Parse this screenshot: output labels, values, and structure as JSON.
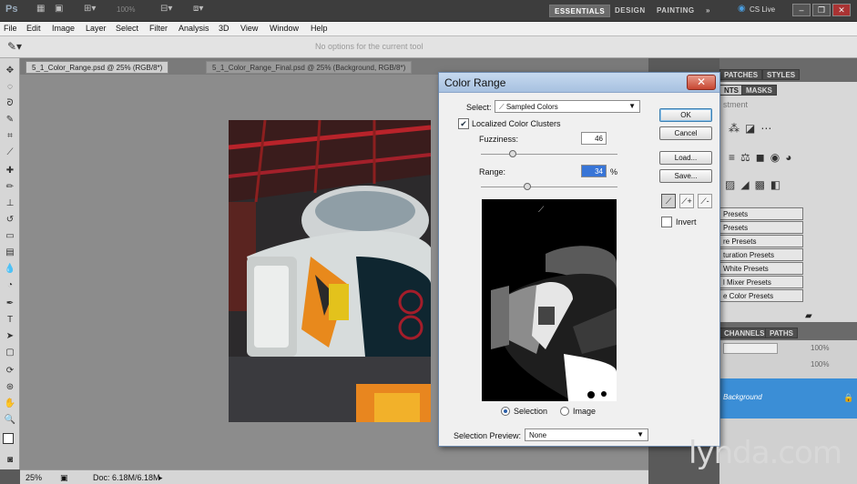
{
  "app": {
    "logo": "Ps",
    "zoom": "100%",
    "workspaces": [
      "ESSENTIALS",
      "DESIGN",
      "PAINTING"
    ],
    "more": "»",
    "cs_live": "CS Live",
    "menu": [
      "File",
      "Edit",
      "Image",
      "Layer",
      "Select",
      "Filter",
      "Analysis",
      "3D",
      "View",
      "Window",
      "Help"
    ],
    "options_message": "No options for the current tool"
  },
  "documents": {
    "tabs": [
      {
        "label": "5_1_Color_Range.psd @ 25% (RGB/8*)",
        "active": true
      },
      {
        "label": "5_1_Color_Range_Final.psd @ 25% (Background, RGB/8*)",
        "active": false
      }
    ]
  },
  "status": {
    "zoom": "25%",
    "doc": "Doc: 6.18M/6.18M"
  },
  "panels": {
    "top_tabs": [
      "PATCHES",
      "STYLES"
    ],
    "adj_tabs": [
      "NTS",
      "MASKS"
    ],
    "adj_label": "stment",
    "presets": [
      "Presets",
      "Presets",
      "re Presets",
      "turation Presets",
      "White Presets",
      "l Mixer Presets",
      "e Color Presets"
    ],
    "layer_tabs": [
      "CHANNELS",
      "PATHS"
    ],
    "opacity": "100%",
    "fill": "100%",
    "background_layer": "Background"
  },
  "dialog": {
    "title": "Color Range",
    "close": "✕",
    "select_label": "Select:",
    "select_value": "Sampled Colors",
    "localized_label": "Localized Color Clusters",
    "localized_checked": true,
    "fuzziness_label": "Fuzziness:",
    "fuzziness_value": "46",
    "range_label": "Range:",
    "range_value": "34",
    "range_unit": "%",
    "buttons": {
      "ok": "OK",
      "cancel": "Cancel",
      "load": "Load...",
      "save": "Save..."
    },
    "invert_label": "Invert",
    "radio_selection": "Selection",
    "radio_image": "Image",
    "preview_label": "Selection Preview:",
    "preview_value": "None"
  },
  "watermark": "lynda.com",
  "colors": {
    "accent": "#3875d7",
    "layer_highlight": "#3b8ed6"
  }
}
